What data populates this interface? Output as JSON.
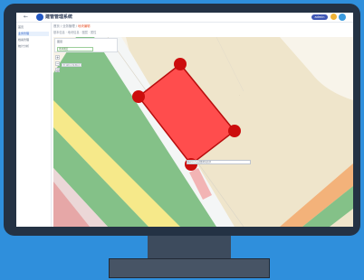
{
  "app": {
    "title": "建管管理系统",
    "user_chip": "admin"
  },
  "sidebar": {
    "items": [
      {
        "label": "首页"
      },
      {
        "label": "业务管理"
      },
      {
        "label": "档案管理"
      },
      {
        "label": "统计分析"
      }
    ]
  },
  "breadcrumb": {
    "items": [
      "首页",
      "业务管理"
    ],
    "current": "地块编辑"
  },
  "subbar": {
    "text": "基本信息 · 地块信息 · 图层 · 属性"
  },
  "map": {
    "panel_title": "图层",
    "panel_field": "地块图层",
    "coords": "E:120.1 N:30.2",
    "tooltip": "拖动节点以调整地块形状",
    "polygon_fill": "#ff4d4d",
    "vertex_color": "#cc0d0d"
  },
  "colors": {
    "background": "#2f8fdc",
    "monitor": "#243244",
    "road_green": "#84c188",
    "road_yellow": "#f6e98a",
    "sand": "#efe5cb"
  }
}
